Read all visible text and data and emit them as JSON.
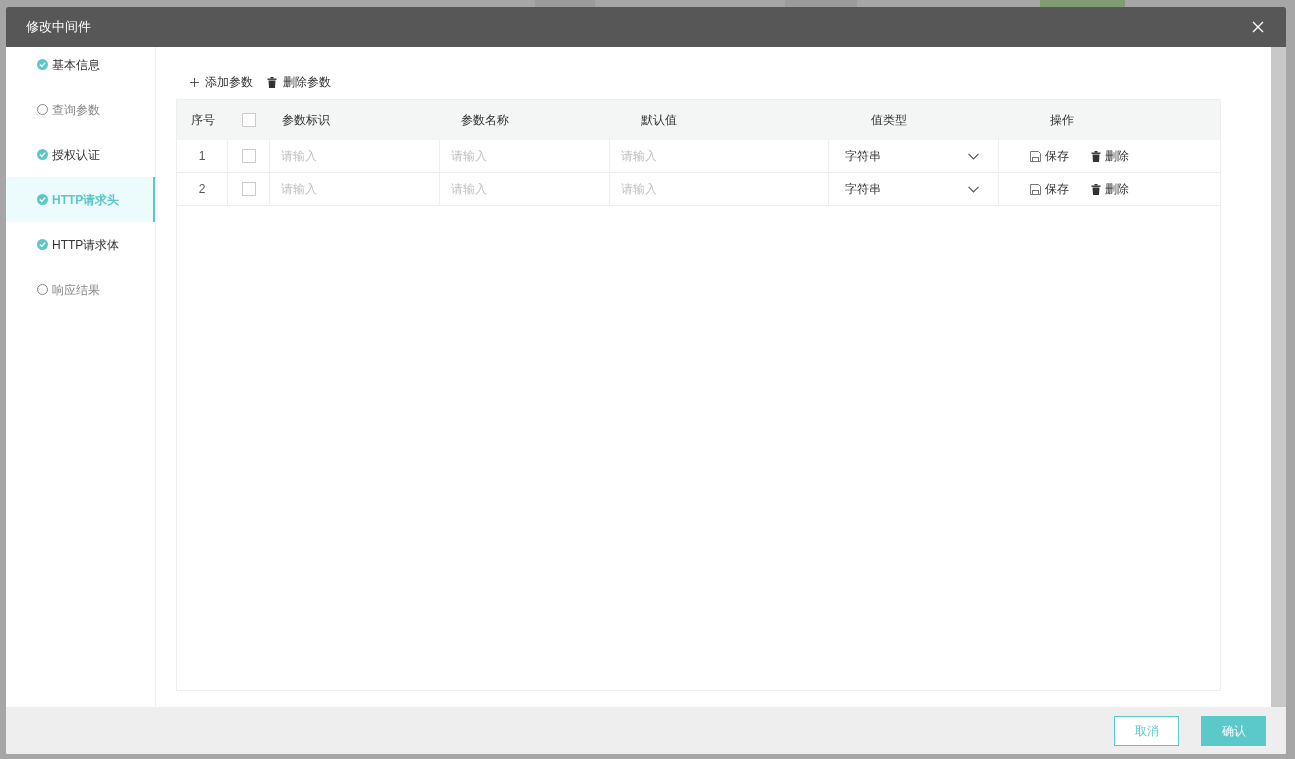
{
  "window": {
    "title": "修改中间件"
  },
  "steps": [
    {
      "label": "基本信息",
      "done": true,
      "selected": false
    },
    {
      "label": "查询参数",
      "done": false,
      "selected": false
    },
    {
      "label": "授权认证",
      "done": true,
      "selected": false
    },
    {
      "label": "HTTP请求头",
      "done": true,
      "selected": true
    },
    {
      "label": "HTTP请求体",
      "done": true,
      "selected": false
    },
    {
      "label": "响应结果",
      "done": false,
      "selected": false
    }
  ],
  "toolbar": [
    {
      "kind": "add",
      "label": "添加参数"
    },
    {
      "kind": "delete",
      "label": "删除参数"
    }
  ],
  "table": {
    "columns": [
      "序号",
      "参数标识",
      "参数名称",
      "默认值",
      "值类型",
      "操作"
    ],
    "header_checked": false,
    "rows": [
      {
        "index": "1",
        "checked": false,
        "placeholders": [
          "请输入",
          "请输入",
          "请输入"
        ],
        "value_type": "字符串",
        "actions": [
          {
            "kind": "save",
            "label": "保存"
          },
          {
            "kind": "delete",
            "label": "删除"
          }
        ]
      },
      {
        "index": "2",
        "checked": false,
        "placeholders": [
          "请输入",
          "请输入",
          "请输入"
        ],
        "value_type": "字符串",
        "actions": [
          {
            "kind": "save",
            "label": "保存"
          },
          {
            "kind": "delete",
            "label": "删除"
          }
        ]
      }
    ]
  },
  "footer": [
    {
      "kind": "secondary",
      "label": "取消"
    },
    {
      "kind": "primary",
      "label": "确认"
    }
  ]
}
